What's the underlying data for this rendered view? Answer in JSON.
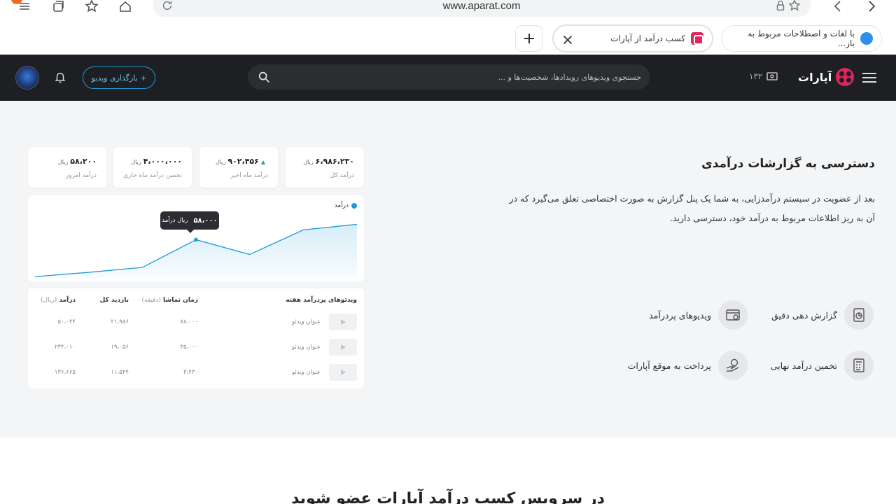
{
  "browser": {
    "url": "www.aparat.com",
    "tabs": [
      {
        "title": "با لغات و اصطلاحات مربوط به باز...",
        "favicon": "globe-icon"
      },
      {
        "title": "کسب درآمد از آپارات",
        "favicon": "aparat-icon"
      }
    ]
  },
  "header": {
    "logo_text": "آپارات",
    "live_count": "۱۳۲",
    "search_placeholder": "جستجوی ویدیوهای رویدادها، شخصیت‌ها و ...",
    "upload_label": "+ بارگذاری ویدیو"
  },
  "hero": {
    "title": "دسترسی به گزارشات درآمدی",
    "description": "بعد از عضویت در سیستم درآمدزایی، به شما یک پنل گزارش به صورت اختصاصی تعلق می‌گیرد که در آن به ریز اطلاعات مربوط به درآمد خود، دسترسی دارید.",
    "features": [
      {
        "label": "گزارش دهی دقیق",
        "icon": "report-icon"
      },
      {
        "label": "ویدیوهای پردرآمد",
        "icon": "video-list-icon"
      },
      {
        "label": "تخمین درآمد نهایی",
        "icon": "calculator-icon"
      },
      {
        "label": "پرداخت به موقع آپارات",
        "icon": "payment-icon"
      }
    ]
  },
  "stats": [
    {
      "value": "۶،۹۸۶،۲۳۰",
      "unit": "ریال",
      "label": "درآمد کل"
    },
    {
      "value": "۹۰۲،۴۵۶",
      "unit": "ریال",
      "label": "درآمد ماه اخیر",
      "trend": "up"
    },
    {
      "value": "۴،۰۰۰،۰۰۰",
      "unit": "ریال",
      "label": "تخمین درآمد ماه جاری"
    },
    {
      "value": "۵۸،۲۰۰",
      "unit": "ریال",
      "label": "درآمد امروز"
    }
  ],
  "chart": {
    "legend": "درآمد",
    "tooltip_value": "۵۸،۰۰۰",
    "tooltip_unit": "ریال درآمد",
    "accent": "#1e9ad6"
  },
  "chart_data": {
    "type": "area",
    "series": [
      {
        "name": "درآمد",
        "values": [
          2,
          9,
          17,
          62,
          38,
          78,
          87
        ]
      }
    ],
    "ylim": [
      0,
      100
    ],
    "highlight_index": 3
  },
  "table": {
    "headers": {
      "videos": "ویدئوهای پردرآمد هفته",
      "watch_time": "زمان تماشا",
      "watch_time_unit": "(دقیقه)",
      "views": "بازدید کل",
      "revenue": "درآمد",
      "revenue_unit": "(ریال)"
    },
    "rows": [
      {
        "title": "عنوان ویدئو",
        "watch_time": "۸۸،۰۰۰",
        "views": "۲۱،۹۸۶",
        "revenue": "۵۰،۰۴۴"
      },
      {
        "title": "عنوان ویدئو",
        "watch_time": "۳۵،۰۰۰",
        "views": "۱۹،۰۵۶",
        "revenue": "۲۳۴،۰۱۰"
      },
      {
        "title": "عنوان ویدئو",
        "watch_time": "۳،۴۳۰",
        "views": "۱۱،۵۴۴",
        "revenue": "۱۳۶،۶۶۵"
      }
    ]
  },
  "lower_heading": "در سرویس کسب درآمد آپارات عضو شوید"
}
